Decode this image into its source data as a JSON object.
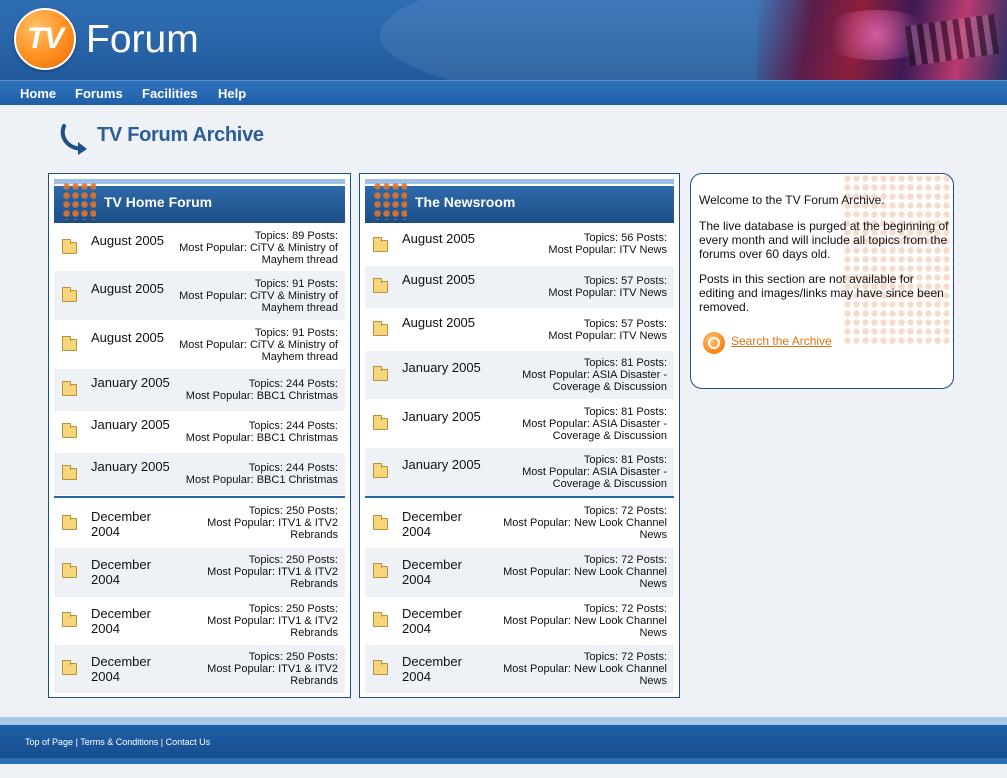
{
  "brand": {
    "logo_mark": "TV",
    "name": "Forum"
  },
  "nav": [
    "Home",
    "Forums",
    "Facilities",
    "Help"
  ],
  "page_title": "TV Forum Archive",
  "panels": [
    {
      "title": "TV Home Forum",
      "rows": [
        {
          "date": "August 2005",
          "topics": "Topics: 89 Posts:",
          "popular": "Most Popular: CiTV & Ministry of Mayhem thread"
        },
        {
          "date": "August 2005",
          "topics": "Topics: 91 Posts:",
          "popular": "Most Popular: CiTV & Ministry of Mayhem thread"
        },
        {
          "date": "August 2005",
          "topics": "Topics: 91 Posts:",
          "popular": "Most Popular: CiTV & Ministry of Mayhem thread"
        },
        {
          "date": "January 2005",
          "topics": "Topics: 244 Posts:",
          "popular": "Most Popular: BBC1 Christmas"
        },
        {
          "date": "January 2005",
          "topics": "Topics: 244 Posts:",
          "popular": "Most Popular: BBC1 Christmas"
        },
        {
          "date": "January 2005",
          "topics": "Topics: 244 Posts:",
          "popular": "Most Popular: BBC1 Christmas"
        },
        {
          "date": "December 2004",
          "topics": "Topics: 250 Posts:",
          "popular": "Most Popular: ITV1 & ITV2 Rebrands"
        },
        {
          "date": "December 2004",
          "topics": "Topics: 250 Posts:",
          "popular": "Most Popular: ITV1 & ITV2 Rebrands"
        },
        {
          "date": "December 2004",
          "topics": "Topics: 250 Posts:",
          "popular": "Most Popular: ITV1 & ITV2 Rebrands"
        },
        {
          "date": "December 2004",
          "topics": "Topics: 250 Posts:",
          "popular": "Most Popular: ITV1 & ITV2 Rebrands"
        }
      ]
    },
    {
      "title": "The Newsroom",
      "rows": [
        {
          "date": "August 2005",
          "topics": "Topics: 56 Posts:",
          "popular": "Most Popular: ITV News"
        },
        {
          "date": "August 2005",
          "topics": "Topics: 57 Posts:",
          "popular": "Most Popular: ITV News"
        },
        {
          "date": "August 2005",
          "topics": "Topics: 57 Posts:",
          "popular": "Most Popular: ITV News"
        },
        {
          "date": "January 2005",
          "topics": "Topics: 81 Posts:",
          "popular": "Most Popular: ASIA Disaster - Coverage & Discussion"
        },
        {
          "date": "January 2005",
          "topics": "Topics: 81 Posts:",
          "popular": "Most Popular: ASIA Disaster - Coverage & Discussion"
        },
        {
          "date": "January 2005",
          "topics": "Topics: 81 Posts:",
          "popular": "Most Popular: ASIA Disaster - Coverage & Discussion"
        },
        {
          "date": "December 2004",
          "topics": "Topics: 72 Posts:",
          "popular": "Most Popular: New Look Channel News"
        },
        {
          "date": "December 2004",
          "topics": "Topics: 72 Posts:",
          "popular": "Most Popular: New Look Channel News"
        },
        {
          "date": "December 2004",
          "topics": "Topics: 72 Posts:",
          "popular": "Most Popular: New Look Channel News"
        },
        {
          "date": "December 2004",
          "topics": "Topics: 72 Posts:",
          "popular": "Most Popular: New Look Channel News"
        }
      ]
    }
  ],
  "welcome": {
    "p1": "Welcome to the TV Forum Archive.",
    "p2": "The live database is purged at the beginning of every month and will include all topics from the forums over 60 days old.",
    "p3": "Posts in this section are not available for editing and images/links may have since been removed.",
    "search_label": "Search the Archive"
  },
  "footer": {
    "links": [
      "Top of Page",
      "Terms & Conditions",
      "Contact Us"
    ],
    "separator": "|"
  }
}
